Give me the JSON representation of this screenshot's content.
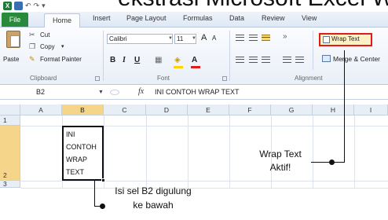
{
  "heading_fragment": "ekstrasi Microsoft Excel Wrap Text Menggulung Teks",
  "quick_access": {
    "app_icon": "X",
    "undo": "↶",
    "redo": "↷",
    "customize": "▾"
  },
  "tabs": [
    "File",
    "Home",
    "Insert",
    "Page Layout",
    "Formulas",
    "Data",
    "Review",
    "View"
  ],
  "clipboard": {
    "paste": "Paste",
    "cut": "Cut",
    "copy": "Copy",
    "copy_arrow": "▾",
    "format_painter": "Format Painter",
    "group_label": "Clipboard"
  },
  "font": {
    "name": "Calibri",
    "size": "11",
    "grow": "A",
    "shrink": "A",
    "bold": "B",
    "italic": "I",
    "underline": "U",
    "borders": "▦",
    "fill": "◈",
    "color": "A",
    "group_label": "Font"
  },
  "alignment": {
    "wrap_text": "Wrap Text",
    "merge_center": "Merge & Center",
    "group_label": "Alignment",
    "orientation": "»"
  },
  "formula_bar": {
    "name_box": "B2",
    "fx": "fx",
    "content": "INI CONTOH WRAP TEXT"
  },
  "columns": [
    "A",
    "B",
    "C",
    "D",
    "E",
    "F",
    "G",
    "H",
    "I"
  ],
  "rows": [
    "1",
    "2",
    "3"
  ],
  "cell_b2_lines": [
    "INI",
    "CONTOH",
    "WRAP",
    "TEXT"
  ],
  "annotation_wrap": [
    "Wrap Text",
    "Aktif!"
  ],
  "annotation_cell": [
    "Isi sel B2 digulung",
    "ke bawah"
  ],
  "colors": {
    "highlight_box": "#e01b1b",
    "file_tab": "#2a8a3c",
    "selected_header": "#f5d58a"
  }
}
